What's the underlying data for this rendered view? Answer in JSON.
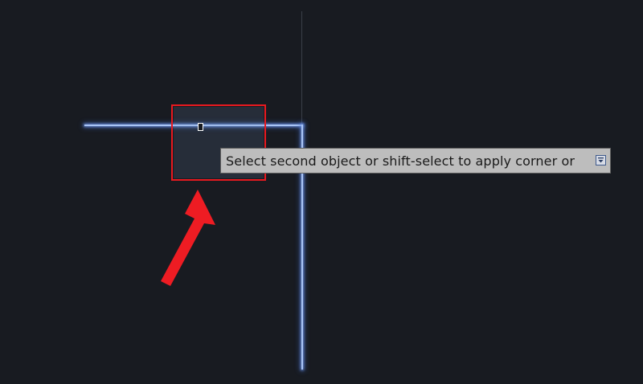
{
  "drawing": {
    "highlight_color": "#a9c4f5",
    "background_color": "#181b21"
  },
  "tooltip": {
    "text": "Select second object or shift-select to apply corner or",
    "expand_icon": "dropdown-arrow-icon"
  },
  "annotation": {
    "color": "#e8191f",
    "box_icon": "highlight-box",
    "arrow_icon": "red-arrow-icon"
  }
}
